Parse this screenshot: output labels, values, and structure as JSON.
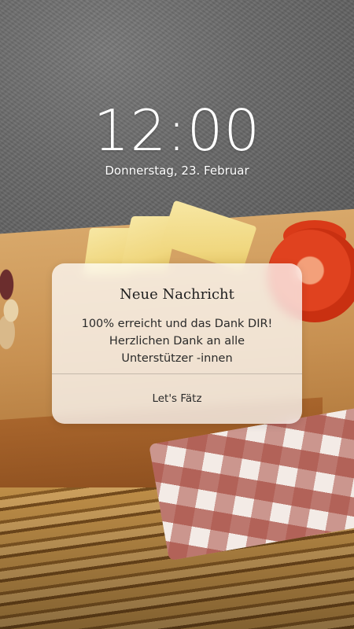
{
  "lockscreen": {
    "time": "12:00",
    "date": "Donnerstag, 23. Februar"
  },
  "notification": {
    "title": "Neue Nachricht",
    "body_lines": [
      "100% erreicht und das Dank DIR!",
      "Herzlichen Dank an alle",
      "Unterstützer -innen"
    ],
    "action_label": "Let's Fätz"
  },
  "colors": {
    "text_on_wallpaper": "#ffffff",
    "card_background": "rgba(255,255,255,0.74)",
    "card_text": "#2a2a2a"
  }
}
